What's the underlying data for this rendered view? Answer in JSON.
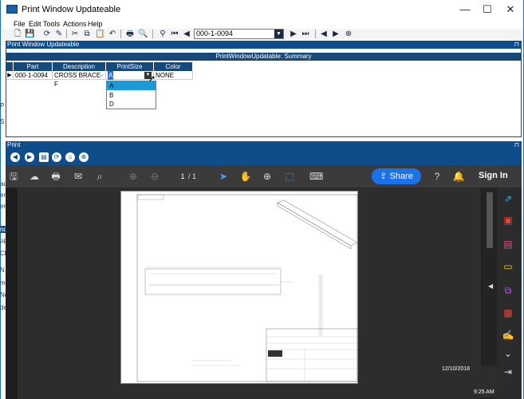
{
  "window": {
    "title": "Print Window Updateable",
    "minimize": "—",
    "maximize": "☐",
    "close": "✕"
  },
  "menu": [
    "File",
    "Edit",
    "Tools",
    "Actions",
    "Help"
  ],
  "toolbar": {
    "part_value": "000-1-0094"
  },
  "update_panel": {
    "title": "Print Window Updateable",
    "summary_title": "PrintWindowUpdatable: Summary",
    "columns": [
      "Part",
      "Description",
      "PrintSize",
      "Color"
    ],
    "row": {
      "part": "000-1-0094",
      "description": "CROSS BRACE-F",
      "print_size": "A",
      "color": "NONE"
    },
    "dropdown_options": [
      "A",
      "B",
      "D"
    ]
  },
  "left_clipped": [
    "P",
    "S",
    "ad",
    "en",
    "ere",
    "nd",
    "up",
    "Cl",
    "N",
    "ms",
    "Ne",
    "de"
  ],
  "print_panel": {
    "title": "Print",
    "page_current": "1",
    "page_total": "/   1",
    "share_label": "Share",
    "signin_label": "Sign In"
  },
  "clock": {
    "date": "12/10/2018",
    "time": "9:25 AM"
  },
  "colors": {
    "panel_blue": "#0f4c8a",
    "share_blue": "#1a73e8"
  }
}
